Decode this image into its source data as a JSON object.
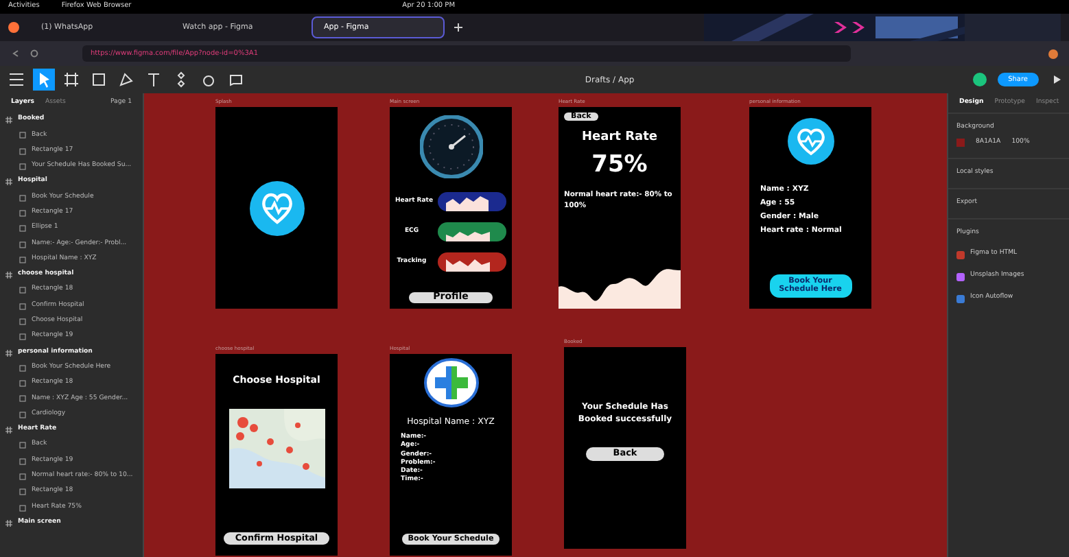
{
  "os_bar": {
    "activities": "Activities",
    "app": "Firefox Web Browser",
    "clock": "Apr 20  1:00 PM"
  },
  "browser": {
    "tabs": [
      {
        "label": "(1) WhatsApp",
        "selected": false
      },
      {
        "label": "Watch app - Figma",
        "selected": false
      },
      {
        "label": "App - Figma",
        "selected": true
      }
    ],
    "url": "https://www.figma.com/file/App?node-id=0%3A1"
  },
  "toolbar": {
    "breadcrumb": "Drafts / App",
    "share": "Share"
  },
  "layers_panel": {
    "tabs": [
      {
        "label": "Layers",
        "selected": true
      },
      {
        "label": "Assets",
        "selected": false
      }
    ],
    "page": "Page 1",
    "layers": [
      {
        "name": "Booked",
        "children": [
          {
            "name": "Back"
          },
          {
            "name": "Rectangle 17"
          },
          {
            "name": "Your Schedule Has Booked Su..."
          }
        ]
      },
      {
        "name": "Hospital",
        "children": [
          {
            "name": "Book Your Schedule"
          },
          {
            "name": "Rectangle 17"
          },
          {
            "name": "Ellipse 1"
          },
          {
            "name": "Name:- Age:- Gender:- Probl..."
          },
          {
            "name": "Hospital Name : XYZ"
          }
        ]
      },
      {
        "name": "choose hospital",
        "children": [
          {
            "name": "Rectangle 18"
          },
          {
            "name": "Confirm Hospital"
          },
          {
            "name": "Choose Hospital"
          },
          {
            "name": "Rectangle 19"
          }
        ]
      },
      {
        "name": "personal information",
        "children": [
          {
            "name": "Book Your Schedule Here"
          },
          {
            "name": "Rectangle 18"
          },
          {
            "name": "Name : XYZ Age : 55 Gender..."
          },
          {
            "name": "Cardiology"
          }
        ]
      },
      {
        "name": "Heart Rate",
        "children": [
          {
            "name": "Back"
          },
          {
            "name": "Rectangle 19"
          },
          {
            "name": "Normal heart rate:- 80% to 10..."
          },
          {
            "name": "Rectangle 18"
          },
          {
            "name": "Heart Rate 75%"
          }
        ]
      },
      {
        "name": "Main screen"
      }
    ]
  },
  "canvas": {
    "frames": [
      {
        "kind": "splash",
        "label": "Splash"
      },
      {
        "kind": "dashboard",
        "label": "Main screen",
        "rows": [
          {
            "label": "Heart Rate",
            "color": "#1b2a8f"
          },
          {
            "label": "ECG",
            "color": "#1f8a4c"
          },
          {
            "label": "Tracking",
            "color": "#b3261e"
          }
        ],
        "button": "Profile"
      },
      {
        "kind": "heart_rate",
        "label": "Heart Rate",
        "back": "Back",
        "title": "Heart Rate",
        "value": "75%",
        "note": "Normal heart rate:- 80% to 100%"
      },
      {
        "kind": "personal",
        "label": "personal information",
        "lines": [
          "Name : XYZ",
          "Age : 55",
          "Gender : Male",
          "Heart rate : Normal"
        ],
        "button": "Book Your Schedule Here"
      },
      {
        "kind": "choose",
        "label": "choose hospital",
        "title": "Choose Hospital",
        "button": "Confirm Hospital"
      },
      {
        "kind": "hospital",
        "label": "Hospital",
        "title": "Hospital Name : XYZ",
        "fields": [
          "Name:-",
          "Age:-",
          "Gender:-",
          "Problem:-",
          "Date:-",
          "Time:-"
        ],
        "button": "Book Your Schedule"
      },
      {
        "kind": "booked",
        "label": "Booked",
        "message": "Your Schedule Has Booked successfully",
        "button": "Back"
      }
    ]
  },
  "design_panel": {
    "tabs": [
      {
        "label": "Design",
        "selected": true
      },
      {
        "label": "Prototype",
        "selected": false
      },
      {
        "label": "Inspect",
        "selected": false
      }
    ],
    "background_label": "Background",
    "background_hex": "8A1A1A",
    "background_opacity": "100%",
    "sections": [
      "Local styles",
      "Export",
      "Plugins"
    ],
    "plugins": [
      {
        "name": "Figma to HTML",
        "color": "#c0392b"
      },
      {
        "name": "Unsplash Images",
        "color": "#b362ff"
      },
      {
        "name": "Icon Autoflow",
        "color": "#3a7bd5"
      }
    ]
  }
}
